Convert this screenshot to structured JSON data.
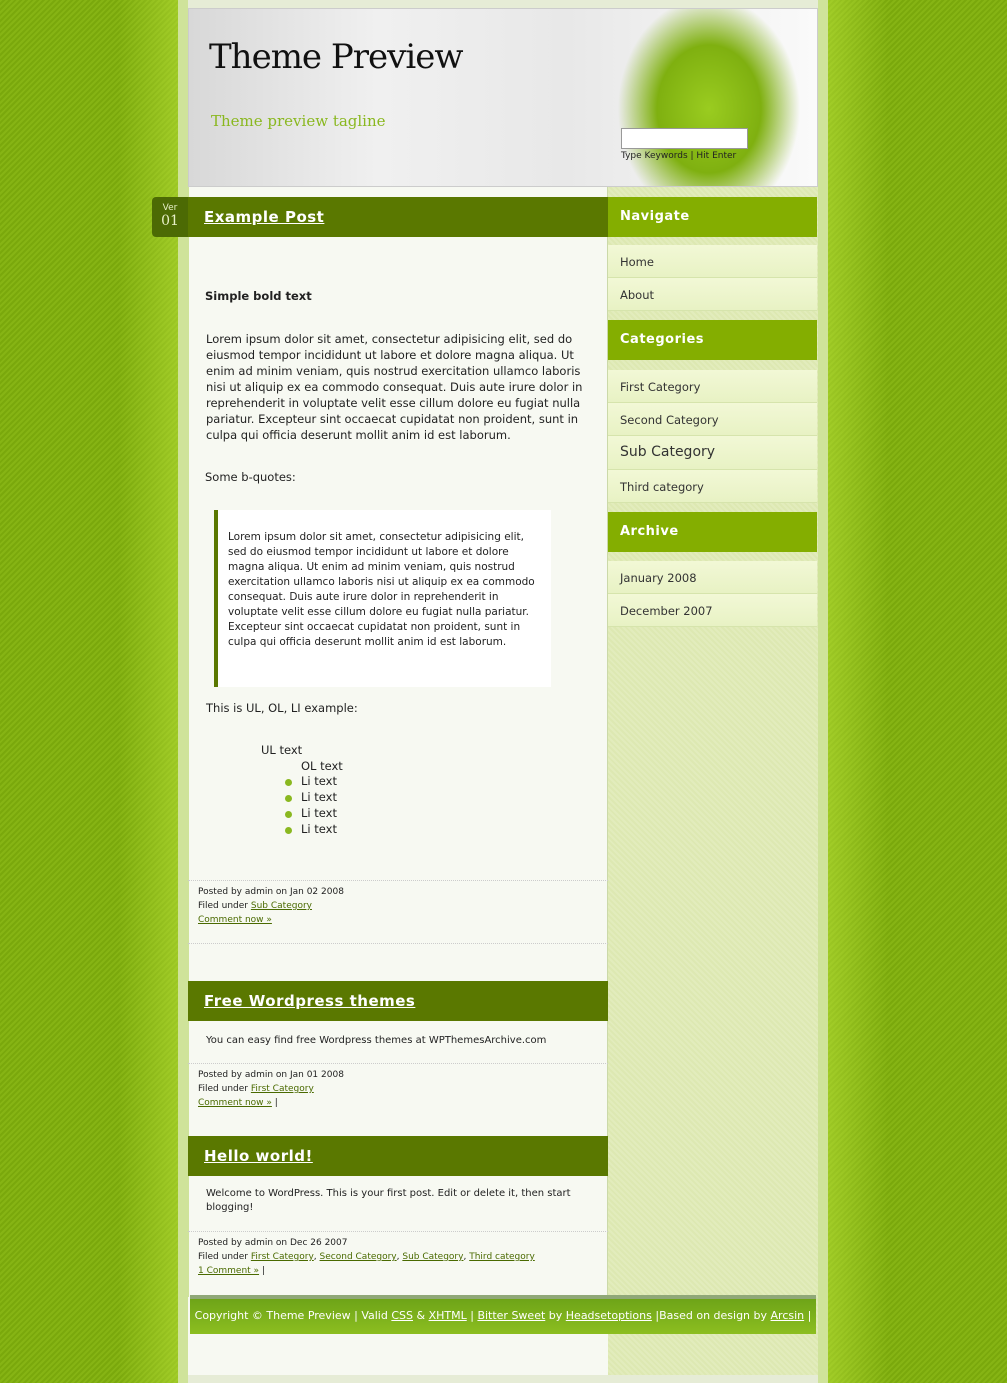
{
  "header": {
    "title": "Theme Preview",
    "tagline": "Theme preview tagline",
    "search_placeholder": "",
    "search_hint": "Type Keywords | Hit Enter"
  },
  "posts": [
    {
      "title": "Example Post",
      "ver_label": "Ver",
      "ver_num": "01",
      "bold": "Simple bold text",
      "para": "Lorem ipsum dolor sit amet, consectetur adipisicing elit, sed do eiusmod tempor incididunt ut labore et dolore magna aliqua. Ut enim ad minim veniam, quis nostrud exercitation ullamco laboris nisi ut aliquip ex ea commodo consequat. Duis aute irure dolor in reprehenderit in voluptate velit esse cillum dolore eu fugiat nulla pariatur. Excepteur sint occaecat cupidatat non proident, sunt in culpa qui officia deserunt mollit anim id est laborum.",
      "bq_label": "Some b-quotes:",
      "blockquote": "Lorem ipsum dolor sit amet, consectetur adipisicing elit, sed do eiusmod tempor incididunt ut labore et dolore magna aliqua. Ut enim ad minim veniam, quis nostrud exercitation ullamco laboris nisi ut aliquip ex ea commodo consequat. Duis aute irure dolor in reprehenderit in voluptate velit esse cillum dolore eu fugiat nulla pariatur. Excepteur sint occaecat cupidatat non proident, sunt in culpa qui officia deserunt mollit anim id est laborum.",
      "list_label": "This is UL, OL, LI example:",
      "ul": "UL text",
      "ol": "OL text",
      "li": [
        "Li text",
        "Li text",
        "Li text",
        "Li text"
      ],
      "posted": "Posted by admin on Jan 02 2008",
      "filed": "Filed under",
      "cats": [
        "Sub Category"
      ],
      "comment": "Comment now »"
    },
    {
      "title": "Free Wordpress themes",
      "body": "You can easy find free Wordpress themes at WPThemesArchive.com",
      "posted": "Posted by admin on Jan 01 2008",
      "filed": "Filed under",
      "cats": [
        "First Category"
      ],
      "comment": "Comment now »",
      "sep": "|"
    },
    {
      "title": "Hello world!",
      "body": "Welcome to WordPress. This is your first post. Edit or delete it, then start blogging!",
      "posted": "Posted by admin on Dec 26 2007",
      "filed": "Filed under",
      "cats": [
        "First Category",
        "Second Category",
        "Sub Category",
        "Third category"
      ],
      "comment": "1 Comment »",
      "sep": "|"
    }
  ],
  "sidebar": {
    "navigate": {
      "title": "Navigate",
      "items": [
        "Home",
        "About"
      ]
    },
    "categories": {
      "title": "Categories",
      "items": [
        "First Category",
        "Second Category",
        "Sub Category",
        "Third category"
      ]
    },
    "archive": {
      "title": "Archive",
      "items": [
        "January 2008",
        "December 2007"
      ]
    }
  },
  "footer": {
    "t1": "Copyright © Theme Preview | Valid ",
    "css": "CSS",
    "t2": " & ",
    "xhtml": "XHTML",
    "t3": " | ",
    "bitter": "Bitter Sweet",
    "t4": " by ",
    "heads": "Headsetoptions",
    "t5": " |Based on design by ",
    "arcsin": "Arcsin",
    "t6": " |"
  },
  "colors": {
    "title_bar": "#5a7800",
    "sidebar_header": "#84ae00",
    "background": "#7aa80c"
  }
}
